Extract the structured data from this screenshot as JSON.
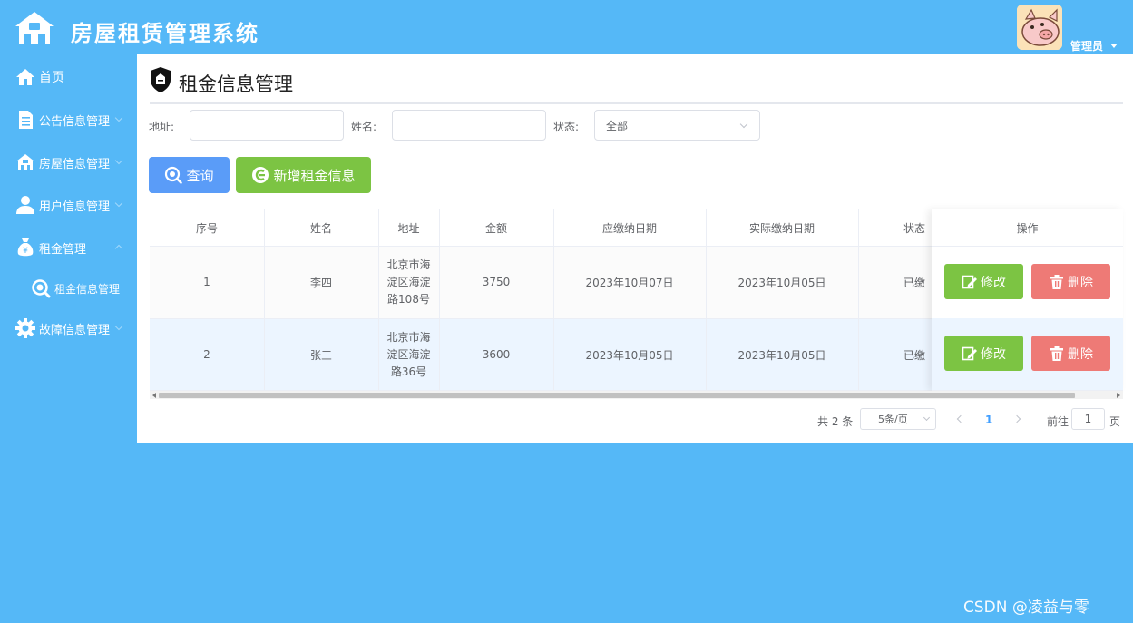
{
  "header": {
    "app_title": "房屋租赁管理系统",
    "user_name": "管理员",
    "logo_icon": "house-icon",
    "avatar": "pig-avatar"
  },
  "sidebar": {
    "items": [
      {
        "label": "首页",
        "icon": "home-icon"
      },
      {
        "label": "公告信息管理",
        "icon": "notice-icon"
      },
      {
        "label": "房屋信息管理",
        "icon": "house-icon"
      },
      {
        "label": "用户信息管理",
        "icon": "user-icon"
      },
      {
        "label": "租金管理",
        "icon": "money-bag-icon",
        "expanded": true,
        "children": [
          {
            "label": "租金信息管理",
            "icon": "search-icon",
            "active": true
          }
        ]
      },
      {
        "label": "故障信息管理",
        "icon": "gear-icon"
      }
    ]
  },
  "page": {
    "title": "租金信息管理",
    "title_icon": "shield-icon"
  },
  "filters": {
    "address_label": "地址:",
    "address_value": "",
    "name_label": "姓名:",
    "name_value": "",
    "status_label": "状态:",
    "status_value": "全部"
  },
  "buttons": {
    "query": "查询",
    "add": "新增租金信息"
  },
  "table": {
    "headers": [
      "序号",
      "姓名",
      "地址",
      "金额",
      "应缴纳日期",
      "实际缴纳日期",
      "状态",
      "操作"
    ],
    "rows": [
      {
        "index": "1",
        "name": "李四",
        "address_lines": [
          "北京市海",
          "淀区海淀",
          "路108号"
        ],
        "amount": "3750",
        "due_date": "2023年10月07日",
        "paid_date": "2023年10月05日",
        "status": "已缴"
      },
      {
        "index": "2",
        "name": "张三",
        "address_lines": [
          "北京市海",
          "淀区海淀",
          "路36号"
        ],
        "amount": "3600",
        "due_date": "2023年10月05日",
        "paid_date": "2023年10月05日",
        "status": "已缴"
      }
    ],
    "edit_label": "修改",
    "delete_label": "删除"
  },
  "pagination": {
    "total": "共 2 条",
    "page_size": "5条/页",
    "current_page": "1",
    "goto_label": "前往",
    "goto_value": "1",
    "page_unit": "页"
  },
  "watermark": "CSDN @凌益与零",
  "colors": {
    "background": "#55b8f7",
    "primary_blue": "#5a9cf8",
    "success_green": "#7cc443",
    "danger_red": "#ee7a76",
    "active_blue": "#409eff"
  }
}
